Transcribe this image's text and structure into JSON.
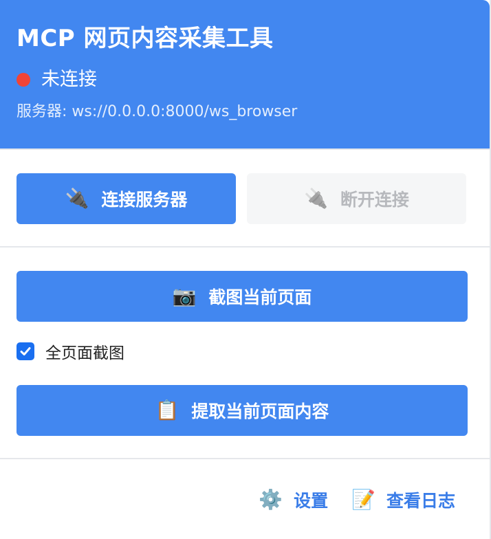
{
  "header": {
    "title": "MCP 网页内容采集工具",
    "status_text": "未连接",
    "status_color": "#f04437",
    "server_line": "服务器: ws://0.0.0.0:8000/ws_browser"
  },
  "connection": {
    "connect_icon": "🔌",
    "connect_label": "连接服务器",
    "disconnect_icon": "🔌",
    "disconnect_label": "断开连接",
    "disconnect_enabled": false
  },
  "actions": {
    "screenshot_icon": "📷",
    "screenshot_label": "截图当前页面",
    "full_page_checked": true,
    "full_page_label": "全页面截图",
    "extract_icon": "📋",
    "extract_label": "提取当前页面内容"
  },
  "footer": {
    "settings_icon": "⚙️",
    "settings_label": "设置",
    "logs_icon": "📝",
    "logs_label": "查看日志"
  },
  "colors": {
    "accent": "#4287f0",
    "checkbox": "#1a6ff0",
    "disabled_bg": "#f5f6f7",
    "disabled_text": "#b7b9bd"
  }
}
